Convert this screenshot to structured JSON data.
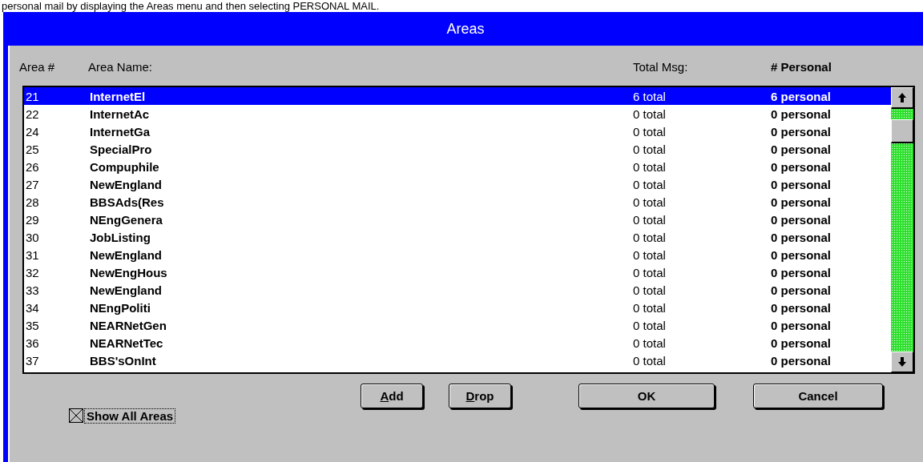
{
  "caption": "personal mail by displaying the Areas menu and then selecting PERSONAL MAIL.",
  "window": {
    "title": "Areas"
  },
  "columns": [
    "Area #",
    "Area Name:",
    "Total Msg:",
    "# Personal"
  ],
  "rows": [
    {
      "number": "21",
      "name": "InternetEl",
      "total": "6 total",
      "personal": "6 personal",
      "selected": true
    },
    {
      "number": "22",
      "name": "InternetAc",
      "total": "0 total",
      "personal": "0 personal",
      "selected": false
    },
    {
      "number": "24",
      "name": "InternetGa",
      "total": "0 total",
      "personal": "0 personal",
      "selected": false
    },
    {
      "number": "25",
      "name": "SpecialPro",
      "total": "0 total",
      "personal": "0 personal",
      "selected": false
    },
    {
      "number": "26",
      "name": "Compuphile",
      "total": "0 total",
      "personal": "0 personal",
      "selected": false
    },
    {
      "number": "27",
      "name": "NewEngland",
      "total": "0 total",
      "personal": "0 personal",
      "selected": false
    },
    {
      "number": "28",
      "name": "BBSAds(Res",
      "total": "0 total",
      "personal": "0 personal",
      "selected": false
    },
    {
      "number": "29",
      "name": "NEngGenera",
      "total": "0 total",
      "personal": "0 personal",
      "selected": false
    },
    {
      "number": "30",
      "name": "JobListing",
      "total": "0 total",
      "personal": "0 personal",
      "selected": false
    },
    {
      "number": "31",
      "name": "NewEngland",
      "total": "0 total",
      "personal": "0 personal",
      "selected": false
    },
    {
      "number": "32",
      "name": "NewEngHous",
      "total": "0 total",
      "personal": "0 personal",
      "selected": false
    },
    {
      "number": "33",
      "name": "NewEngland",
      "total": "0 total",
      "personal": "0 personal",
      "selected": false
    },
    {
      "number": "34",
      "name": "NEngPoliti",
      "total": "0 total",
      "personal": "0 personal",
      "selected": false
    },
    {
      "number": "35",
      "name": "NEARNetGen",
      "total": "0 total",
      "personal": "0 personal",
      "selected": false
    },
    {
      "number": "36",
      "name": "NEARNetTec",
      "total": "0 total",
      "personal": "0 personal",
      "selected": false
    },
    {
      "number": "37",
      "name": "BBS'sOnInt",
      "total": "0 total",
      "personal": "0 personal",
      "selected": false
    }
  ],
  "show_all": {
    "label": "Show All Areas",
    "checked": true
  },
  "buttons": [
    {
      "label": "Add",
      "mnemonic": true
    },
    {
      "label": "Drop",
      "mnemonic": true
    },
    {
      "label": "OK",
      "mnemonic": false
    },
    {
      "label": "Cancel",
      "mnemonic": false
    }
  ]
}
